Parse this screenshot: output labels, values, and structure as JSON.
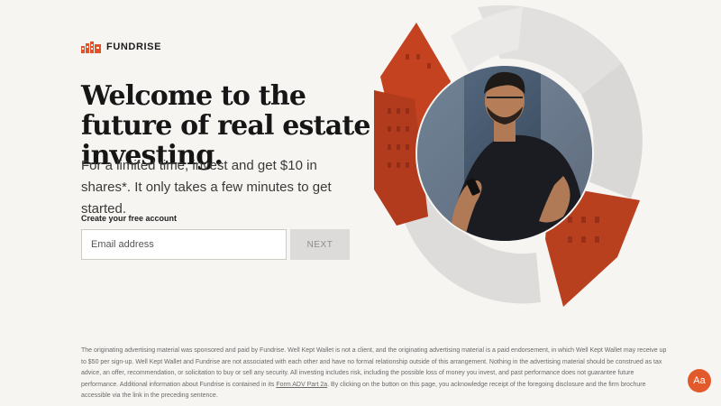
{
  "brand": {
    "name": "FUNDRISE",
    "accent": "#e0532a",
    "icon": "fundrise-logo-icon"
  },
  "hero": {
    "headline": "Welcome to the future of real estate investing.",
    "subhead": "For a limited time, invest and get $10 in shares*. It only takes a few minutes to get started."
  },
  "form": {
    "label": "Create your free account",
    "email_placeholder": "Email address",
    "email_value": "",
    "next_label": "NEXT"
  },
  "disclaimer": {
    "text_before_link": "The originating advertising material was sponsored and paid by Fundrise. Well Kept Wallet is not a client, and the originating advertising material is a paid endorsement, in which Well Kept Wallet may receive up to $50 per sign-up. Well Kept Wallet and Fundrise are not associated with each other and have no formal relationship outside of this arrangement. Nothing in the advertising material should be construed as tax advice, an offer, recommendation, or solicitation to buy or sell any security. All investing includes risk, including the possible loss of money you invest, and past performance does not guarantee future performance. Additional information about Fundrise is contained in its ",
    "link_text": "Form ADV Part 2a",
    "text_after_link": ". By clicking on the button on this page, you acknowledge receipt of the foregoing disclosure and the firm brochure accessible via the link in the preceding sentence."
  },
  "accessibility_button": {
    "label": "Aa",
    "color": "#e25a2c"
  }
}
